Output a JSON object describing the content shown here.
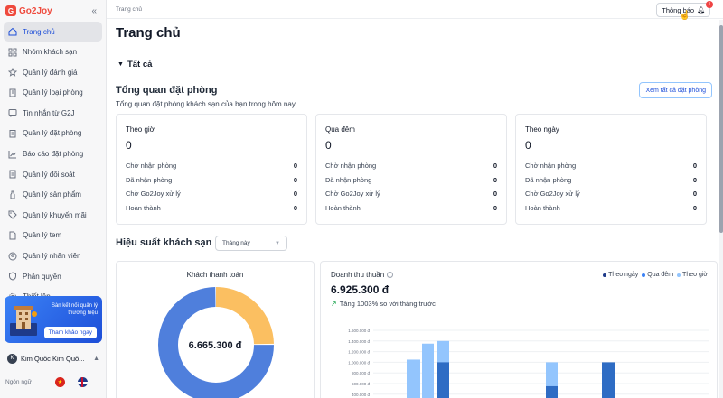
{
  "brand": {
    "name": "Go2Joy",
    "logo_mark": "G"
  },
  "sidebar": {
    "collapse_icon": "«",
    "items": [
      {
        "label": "Trang chủ",
        "icon": "home-icon",
        "active": true
      },
      {
        "label": "Nhóm khách sạn",
        "icon": "grid-icon"
      },
      {
        "label": "Quản lý đánh giá",
        "icon": "star-icon"
      },
      {
        "label": "Quản lý loại phòng",
        "icon": "building-icon"
      },
      {
        "label": "Tin nhắn từ G2J",
        "icon": "message-icon"
      },
      {
        "label": "Quản lý đặt phòng",
        "icon": "clipboard-icon"
      },
      {
        "label": "Báo cáo đặt phòng",
        "icon": "chart-icon"
      },
      {
        "label": "Quản lý đối soát",
        "icon": "document-icon"
      },
      {
        "label": "Quản lý sản phẩm",
        "icon": "bottle-icon"
      },
      {
        "label": "Quản lý khuyến mãi",
        "icon": "tag-icon"
      },
      {
        "label": "Quản lý tem",
        "icon": "file-icon"
      },
      {
        "label": "Quản lý nhân viên",
        "icon": "user-circle-icon"
      },
      {
        "label": "Phân quyền",
        "icon": "shield-icon"
      },
      {
        "label": "Thiết lập",
        "icon": "settings-icon"
      }
    ],
    "promo": {
      "text": "Sàn kết nối quản lý thương hiệu",
      "button": "Tham khảo ngay"
    },
    "hotel": {
      "avatar": "K",
      "name": "Kim Quốc Kim Quố..."
    },
    "language_label": "Ngôn ngữ"
  },
  "topbar": {
    "breadcrumb": "Trang chủ",
    "notif_label": "Thông báo",
    "notif_count": "1"
  },
  "page": {
    "title": "Trang chủ",
    "section_toggle": "Tất cả",
    "overview_title": "Tổng quan đặt phòng",
    "overview_subtitle": "Tổng quan đặt phòng khách sạn của bạn trong hôm nay",
    "view_all": "Xem tất cả đặt phòng"
  },
  "cards": [
    {
      "title": "Theo giờ",
      "total": "0",
      "rows": [
        {
          "label": "Chờ nhận phòng",
          "value": "0"
        },
        {
          "label": "Đã nhận phòng",
          "value": "0"
        },
        {
          "label": "Chờ Go2Joy xử lý",
          "value": "0"
        },
        {
          "label": "Hoàn thành",
          "value": "0"
        }
      ]
    },
    {
      "title": "Qua đêm",
      "total": "0",
      "rows": [
        {
          "label": "Chờ nhận phòng",
          "value": "0"
        },
        {
          "label": "Đã nhận phòng",
          "value": "0"
        },
        {
          "label": "Chờ Go2Joy xử lý",
          "value": "0"
        },
        {
          "label": "Hoàn thành",
          "value": "0"
        }
      ]
    },
    {
      "title": "Theo ngày",
      "total": "0",
      "rows": [
        {
          "label": "Chờ nhận phòng",
          "value": "0"
        },
        {
          "label": "Đã nhận phòng",
          "value": "0"
        },
        {
          "label": "Chờ Go2Joy xử lý",
          "value": "0"
        },
        {
          "label": "Hoàn thành",
          "value": "0"
        }
      ]
    }
  ],
  "performance": {
    "title": "Hiệu suất khách sạn",
    "period": "Tháng này",
    "donut": {
      "title": "Khách thanh toán",
      "center": "6.665.300 đ",
      "slices": [
        {
          "share": 0.25,
          "color": "#fbbf61"
        },
        {
          "share": 0.75,
          "color": "#4f7fdc"
        }
      ]
    },
    "revenue": {
      "title": "Doanh thu thuần",
      "amount": "6.925.300 đ",
      "growth": "Tăng 1003% so với tháng trước"
    }
  },
  "colors": {
    "accent": "#1d4ed8",
    "theo_ngay": "#1e3a8a",
    "qua_dem": "#3b82f6",
    "theo_gio": "#93c5fd"
  },
  "chart_data": {
    "type": "bar",
    "yticks": [
      "1.600.000 đ",
      "1.400.000 đ",
      "1.200.000 đ",
      "1.000.000 đ",
      "800.000 đ",
      "600.000 đ",
      "400.000 đ"
    ],
    "ylim": [
      400000,
      1600000
    ],
    "legend": [
      "Theo ngày",
      "Qua đêm",
      "Theo giờ"
    ],
    "legend_position": "top-right",
    "series": [
      {
        "name": "Theo ngày",
        "values": [
          0,
          0,
          1000000,
          0,
          550000,
          1000000
        ]
      },
      {
        "name": "Qua đêm",
        "values": [
          0,
          0,
          0,
          0,
          0,
          0
        ]
      },
      {
        "name": "Theo giờ",
        "values": [
          1050000,
          1350000,
          1400000,
          0,
          1000000,
          0
        ]
      }
    ]
  }
}
